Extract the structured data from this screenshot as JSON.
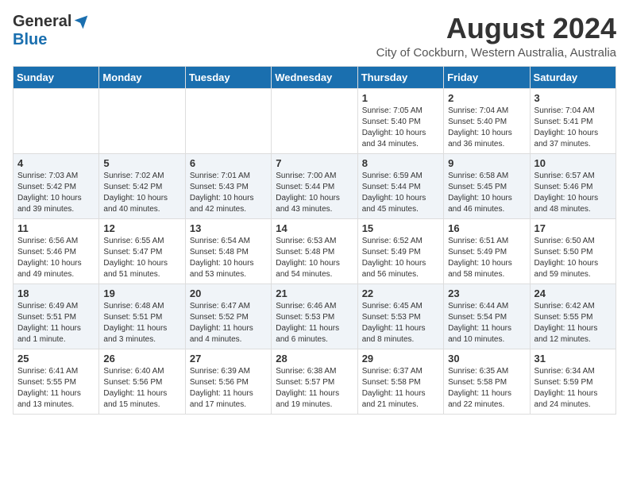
{
  "header": {
    "logo_general": "General",
    "logo_blue": "Blue",
    "month_title": "August 2024",
    "location": "City of Cockburn, Western Australia, Australia"
  },
  "weekdays": [
    "Sunday",
    "Monday",
    "Tuesday",
    "Wednesday",
    "Thursday",
    "Friday",
    "Saturday"
  ],
  "weeks": [
    [
      {
        "day": "",
        "info": ""
      },
      {
        "day": "",
        "info": ""
      },
      {
        "day": "",
        "info": ""
      },
      {
        "day": "",
        "info": ""
      },
      {
        "day": "1",
        "info": "Sunrise: 7:05 AM\nSunset: 5:40 PM\nDaylight: 10 hours\nand 34 minutes."
      },
      {
        "day": "2",
        "info": "Sunrise: 7:04 AM\nSunset: 5:40 PM\nDaylight: 10 hours\nand 36 minutes."
      },
      {
        "day": "3",
        "info": "Sunrise: 7:04 AM\nSunset: 5:41 PM\nDaylight: 10 hours\nand 37 minutes."
      }
    ],
    [
      {
        "day": "4",
        "info": "Sunrise: 7:03 AM\nSunset: 5:42 PM\nDaylight: 10 hours\nand 39 minutes."
      },
      {
        "day": "5",
        "info": "Sunrise: 7:02 AM\nSunset: 5:42 PM\nDaylight: 10 hours\nand 40 minutes."
      },
      {
        "day": "6",
        "info": "Sunrise: 7:01 AM\nSunset: 5:43 PM\nDaylight: 10 hours\nand 42 minutes."
      },
      {
        "day": "7",
        "info": "Sunrise: 7:00 AM\nSunset: 5:44 PM\nDaylight: 10 hours\nand 43 minutes."
      },
      {
        "day": "8",
        "info": "Sunrise: 6:59 AM\nSunset: 5:44 PM\nDaylight: 10 hours\nand 45 minutes."
      },
      {
        "day": "9",
        "info": "Sunrise: 6:58 AM\nSunset: 5:45 PM\nDaylight: 10 hours\nand 46 minutes."
      },
      {
        "day": "10",
        "info": "Sunrise: 6:57 AM\nSunset: 5:46 PM\nDaylight: 10 hours\nand 48 minutes."
      }
    ],
    [
      {
        "day": "11",
        "info": "Sunrise: 6:56 AM\nSunset: 5:46 PM\nDaylight: 10 hours\nand 49 minutes."
      },
      {
        "day": "12",
        "info": "Sunrise: 6:55 AM\nSunset: 5:47 PM\nDaylight: 10 hours\nand 51 minutes."
      },
      {
        "day": "13",
        "info": "Sunrise: 6:54 AM\nSunset: 5:48 PM\nDaylight: 10 hours\nand 53 minutes."
      },
      {
        "day": "14",
        "info": "Sunrise: 6:53 AM\nSunset: 5:48 PM\nDaylight: 10 hours\nand 54 minutes."
      },
      {
        "day": "15",
        "info": "Sunrise: 6:52 AM\nSunset: 5:49 PM\nDaylight: 10 hours\nand 56 minutes."
      },
      {
        "day": "16",
        "info": "Sunrise: 6:51 AM\nSunset: 5:49 PM\nDaylight: 10 hours\nand 58 minutes."
      },
      {
        "day": "17",
        "info": "Sunrise: 6:50 AM\nSunset: 5:50 PM\nDaylight: 10 hours\nand 59 minutes."
      }
    ],
    [
      {
        "day": "18",
        "info": "Sunrise: 6:49 AM\nSunset: 5:51 PM\nDaylight: 11 hours\nand 1 minute."
      },
      {
        "day": "19",
        "info": "Sunrise: 6:48 AM\nSunset: 5:51 PM\nDaylight: 11 hours\nand 3 minutes."
      },
      {
        "day": "20",
        "info": "Sunrise: 6:47 AM\nSunset: 5:52 PM\nDaylight: 11 hours\nand 4 minutes."
      },
      {
        "day": "21",
        "info": "Sunrise: 6:46 AM\nSunset: 5:53 PM\nDaylight: 11 hours\nand 6 minutes."
      },
      {
        "day": "22",
        "info": "Sunrise: 6:45 AM\nSunset: 5:53 PM\nDaylight: 11 hours\nand 8 minutes."
      },
      {
        "day": "23",
        "info": "Sunrise: 6:44 AM\nSunset: 5:54 PM\nDaylight: 11 hours\nand 10 minutes."
      },
      {
        "day": "24",
        "info": "Sunrise: 6:42 AM\nSunset: 5:55 PM\nDaylight: 11 hours\nand 12 minutes."
      }
    ],
    [
      {
        "day": "25",
        "info": "Sunrise: 6:41 AM\nSunset: 5:55 PM\nDaylight: 11 hours\nand 13 minutes."
      },
      {
        "day": "26",
        "info": "Sunrise: 6:40 AM\nSunset: 5:56 PM\nDaylight: 11 hours\nand 15 minutes."
      },
      {
        "day": "27",
        "info": "Sunrise: 6:39 AM\nSunset: 5:56 PM\nDaylight: 11 hours\nand 17 minutes."
      },
      {
        "day": "28",
        "info": "Sunrise: 6:38 AM\nSunset: 5:57 PM\nDaylight: 11 hours\nand 19 minutes."
      },
      {
        "day": "29",
        "info": "Sunrise: 6:37 AM\nSunset: 5:58 PM\nDaylight: 11 hours\nand 21 minutes."
      },
      {
        "day": "30",
        "info": "Sunrise: 6:35 AM\nSunset: 5:58 PM\nDaylight: 11 hours\nand 22 minutes."
      },
      {
        "day": "31",
        "info": "Sunrise: 6:34 AM\nSunset: 5:59 PM\nDaylight: 11 hours\nand 24 minutes."
      }
    ]
  ]
}
